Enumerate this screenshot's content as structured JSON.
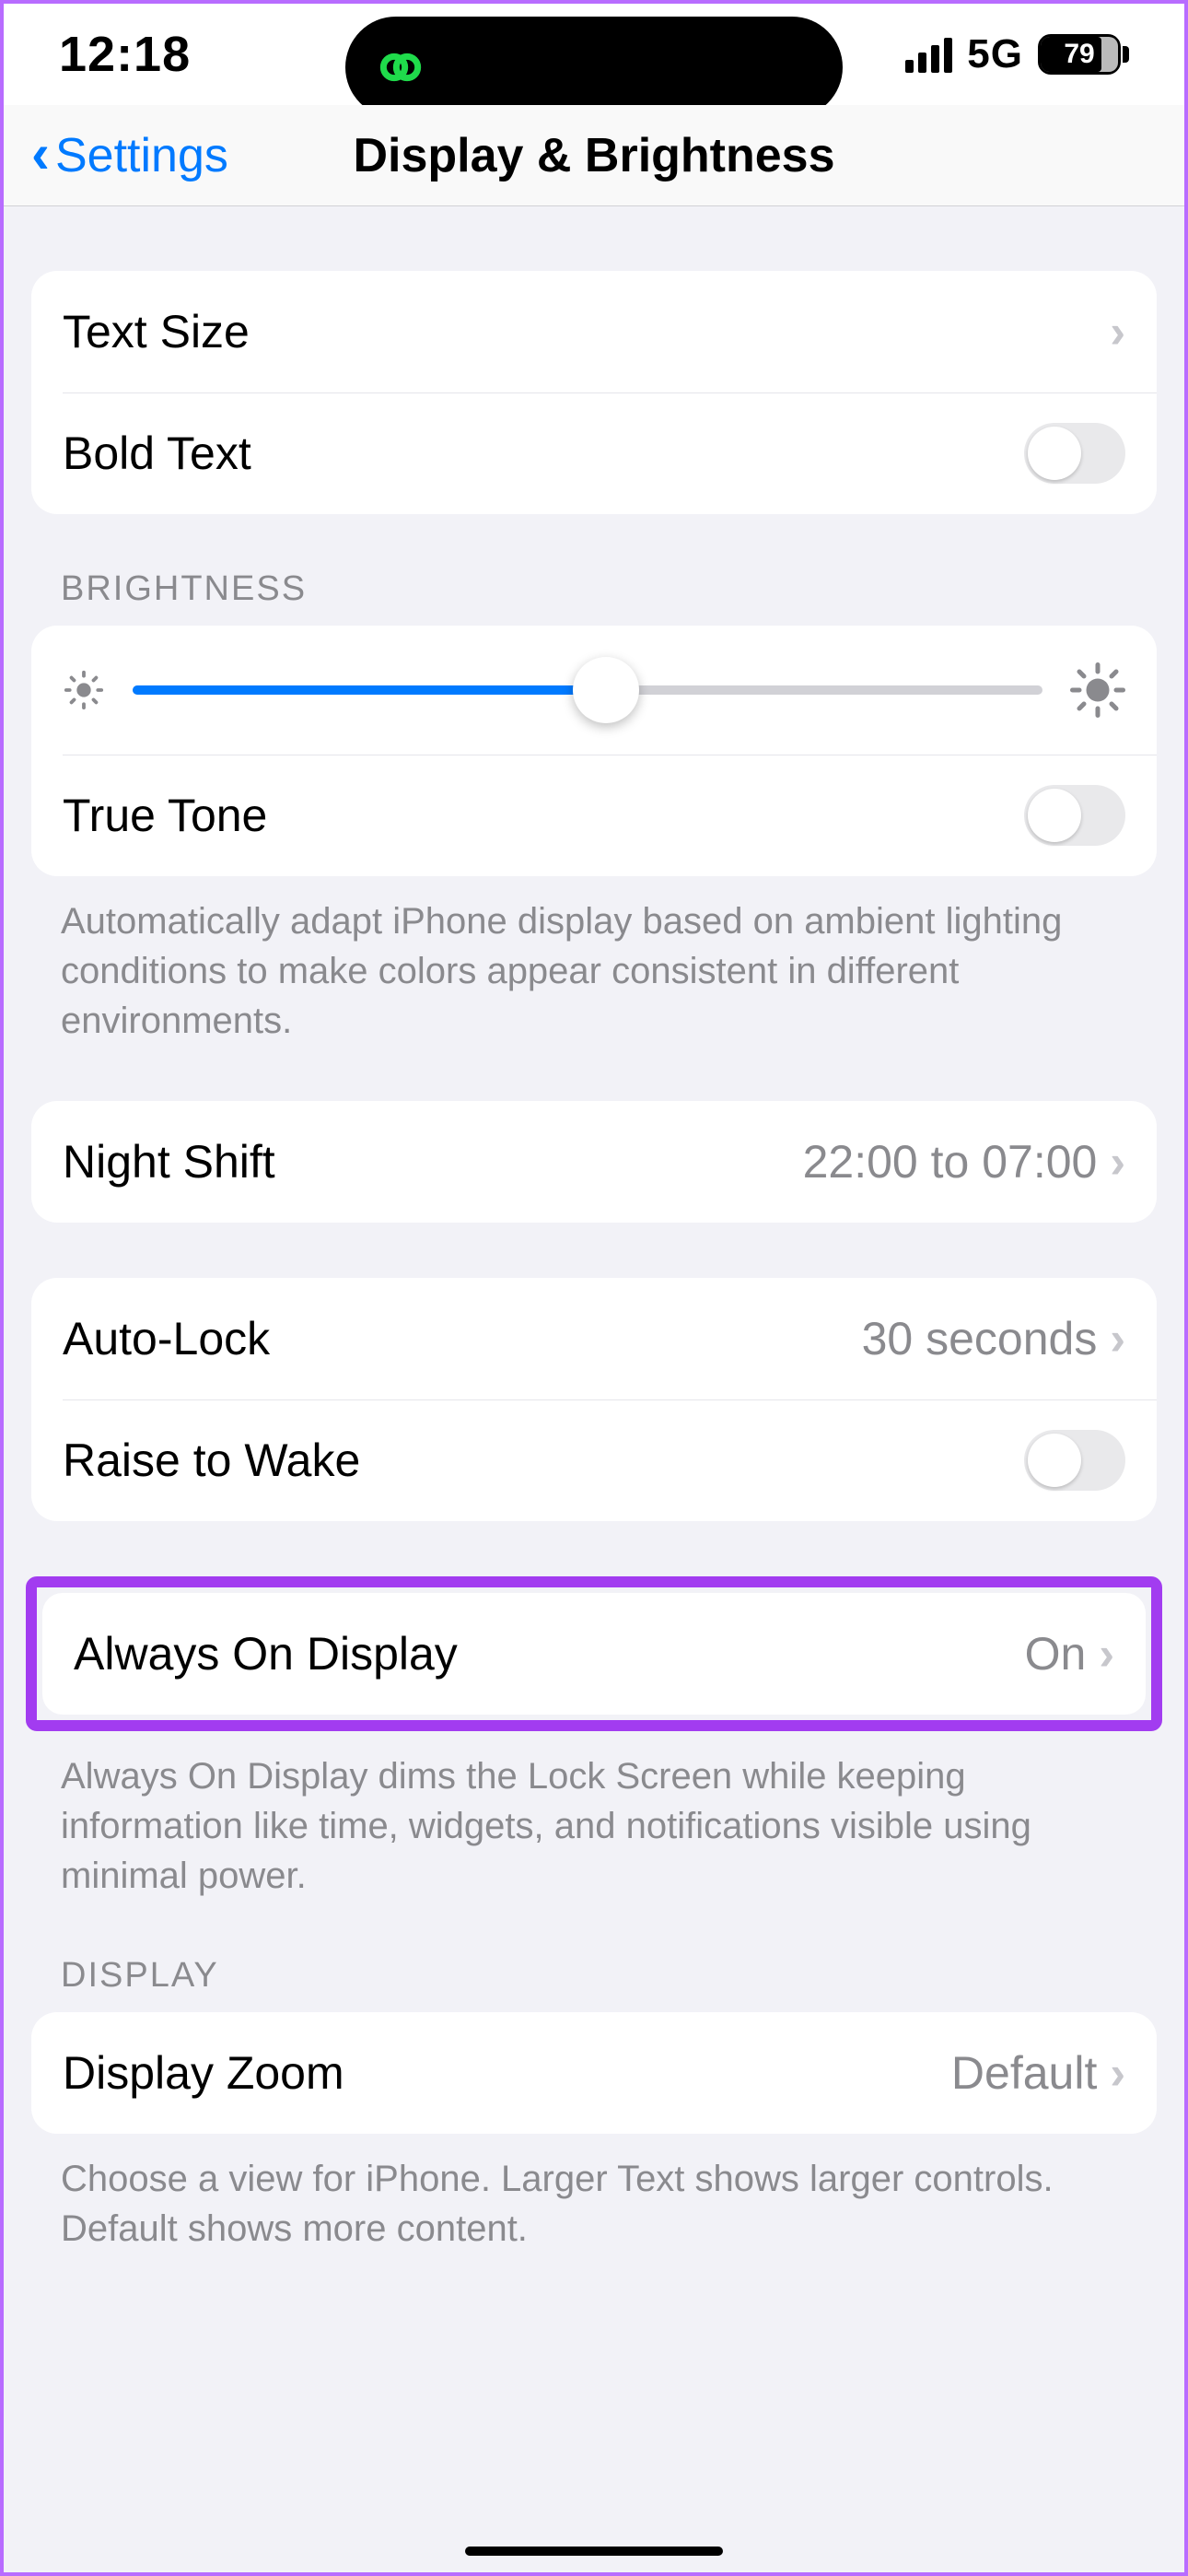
{
  "status": {
    "time": "12:18",
    "network": "5G",
    "battery_pct": "79"
  },
  "nav": {
    "back_label": "Settings",
    "title": "Display & Brightness"
  },
  "group_text": {
    "header": "BRIGHTNESS",
    "text_size": "Text Size",
    "bold_text": "Bold Text"
  },
  "brightness": {
    "true_tone": "True Tone",
    "footer": "Automatically adapt iPhone display based on ambient lighting conditions to make colors appear consistent in different environments."
  },
  "night_shift": {
    "label": "Night Shift",
    "value": "22:00 to 07:00"
  },
  "lock": {
    "auto_lock": "Auto-Lock",
    "auto_lock_val": "30 seconds",
    "raise": "Raise to Wake"
  },
  "aod": {
    "label": "Always On Display",
    "value": "On",
    "footer": "Always On Display dims the Lock Screen while keeping information like time, widgets, and notifications visible using minimal power."
  },
  "display": {
    "header": "DISPLAY",
    "zoom": "Display Zoom",
    "zoom_val": "Default",
    "footer": "Choose a view for iPhone. Larger Text shows larger controls. Default shows more content."
  }
}
